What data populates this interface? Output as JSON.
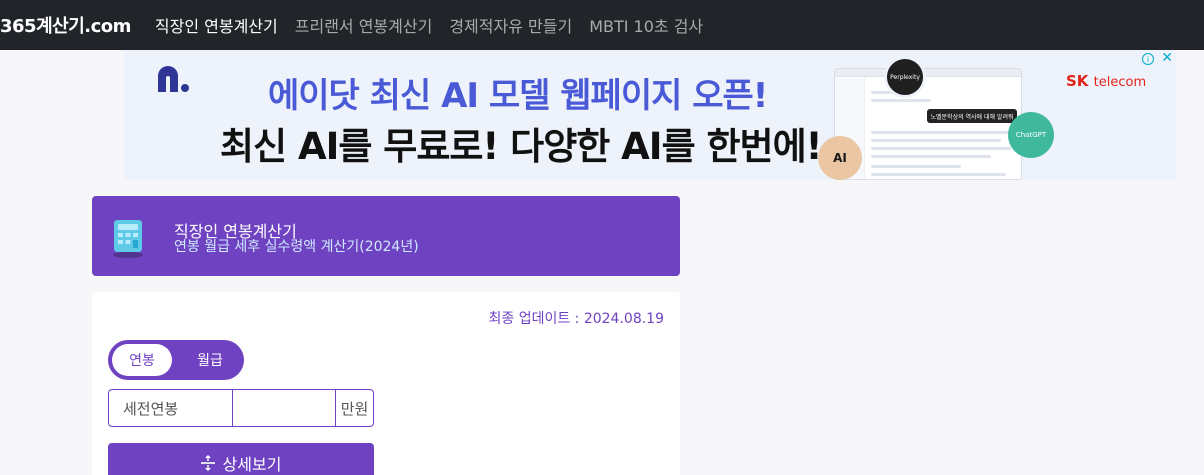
{
  "nav": {
    "brand": "365계산기.com",
    "links": [
      {
        "label": "직장인 연봉계산기"
      },
      {
        "label": "프리랜서 연봉계산기"
      },
      {
        "label": "경제적자유 만들기"
      },
      {
        "label": "MBTI 10초 검사"
      }
    ]
  },
  "ad": {
    "headline": "에이닷 최신 AI 모델 웹페이지 오픈!",
    "subline": "최신 AI를 무료로! 다양한 AI를 한번에!",
    "mock_pill": "노벨문학상의 역사에 대해 알려줘",
    "badge_perplexity": "Perplexity",
    "badge_claude": "AI",
    "badge_gpt": "ChatGPT",
    "sponsor_brand": "SK",
    "sponsor_sub": "telecom",
    "info_icon": "info-icon",
    "close_icon": "close-icon"
  },
  "hero": {
    "title": "직장인 연봉계산기",
    "subtitle": "연봉 월급 세후 실수령액 계산기(2024년)",
    "icon": "calculator-icon"
  },
  "form": {
    "updated": "최종 업데이트 : 2024.08.19",
    "toggle": {
      "annual": "연봉",
      "monthly": "월급"
    },
    "salary_label": "세전연봉",
    "salary_value": "",
    "salary_unit": "만원",
    "detail_button": "상세보기",
    "detail_icon": "expand-vertical-icon"
  },
  "colors": {
    "accent": "#6f42c1",
    "nav_bg": "#212529"
  }
}
